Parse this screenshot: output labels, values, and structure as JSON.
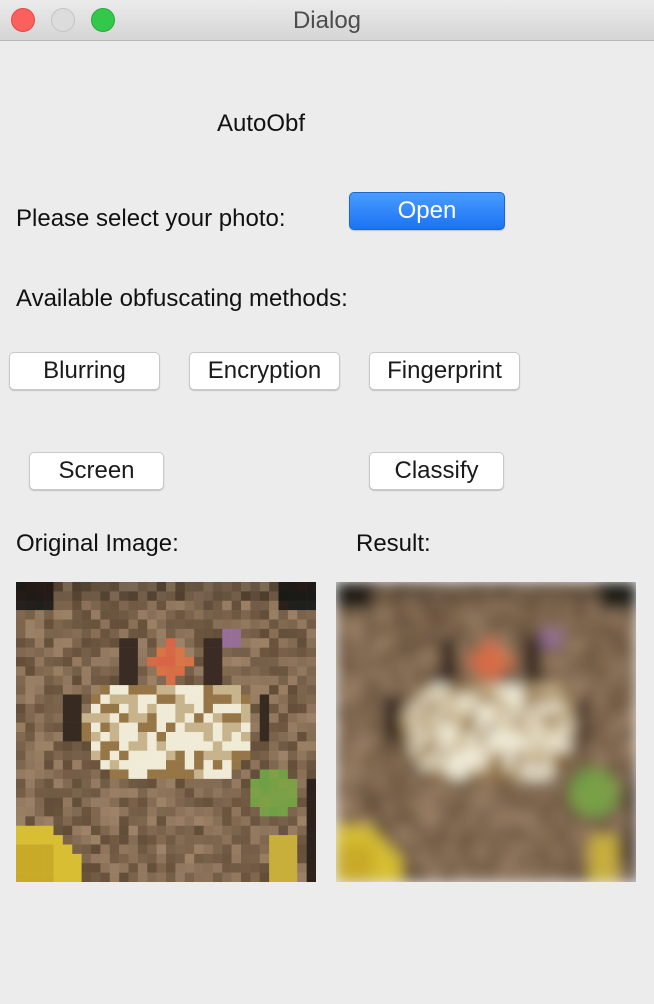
{
  "window": {
    "title": "Dialog"
  },
  "app_title": "AutoObf",
  "select_photo_label": "Please select your photo:",
  "open_button": "Open",
  "methods_label": "Available obfuscating methods:",
  "methods": {
    "blurring": "Blurring",
    "encryption": "Encryption",
    "fingerprint": "Fingerprint",
    "screen": "Screen",
    "classify": "Classify"
  },
  "original_label": "Original Image:",
  "result_label": "Result:",
  "colors": {
    "primary_button": "#1a73f4",
    "close": "#fc605c",
    "zoom": "#34c84a"
  }
}
